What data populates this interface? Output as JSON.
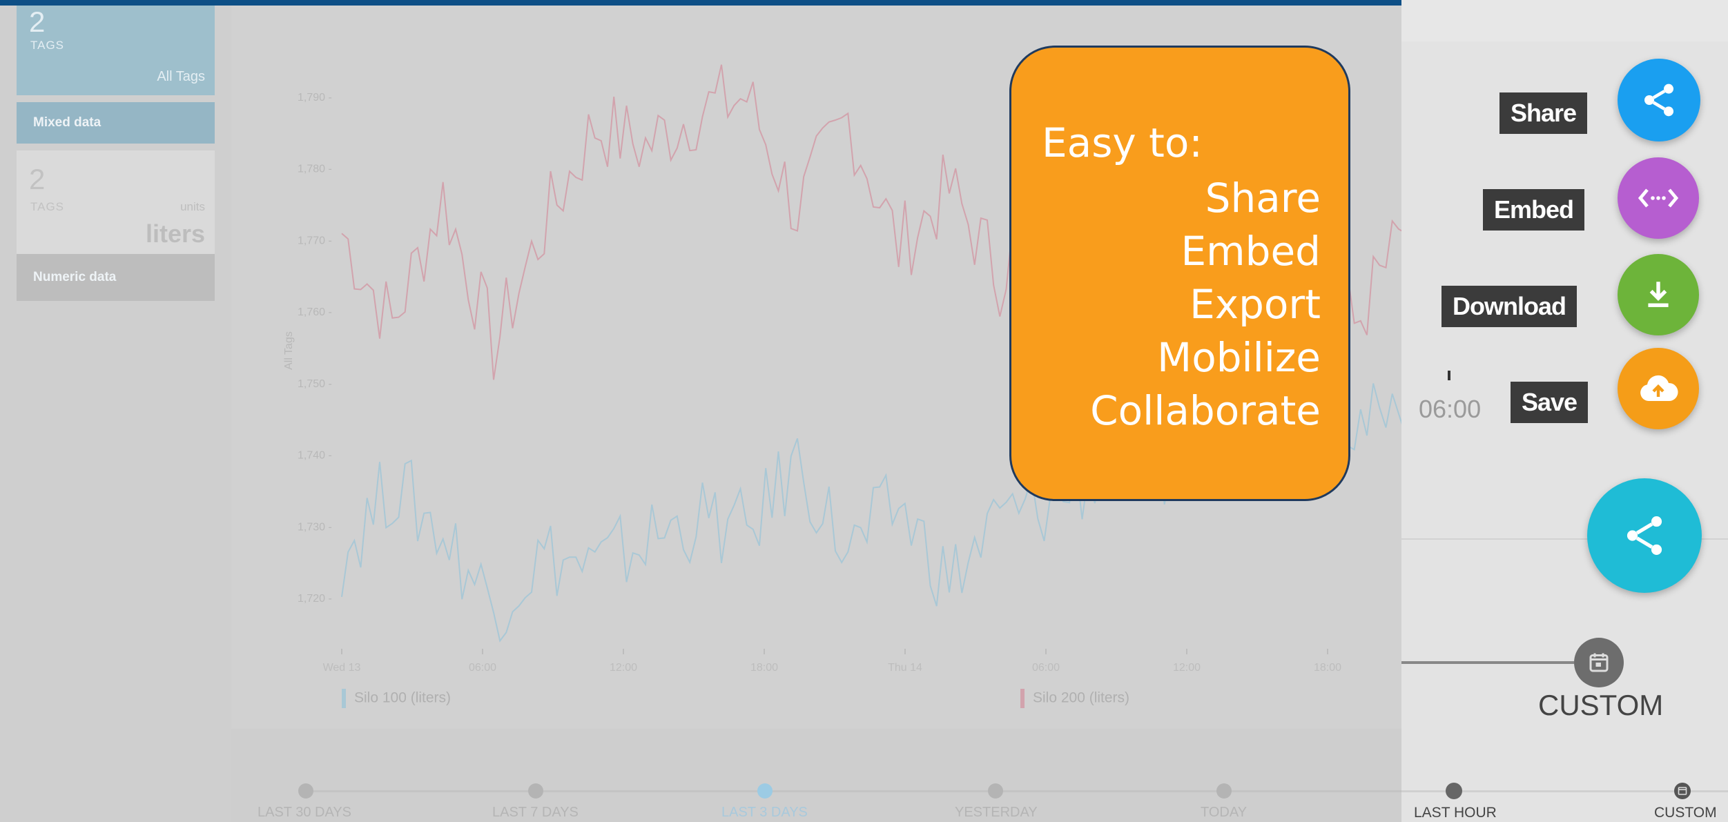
{
  "sidebar": {
    "card1": {
      "count": "2",
      "count_label": "TAGS",
      "right_label": "All Tags",
      "band": "Mixed data"
    },
    "card2": {
      "count": "2",
      "count_label": "TAGS",
      "units_label": "units",
      "units_value": "liters",
      "band": "Numeric data"
    }
  },
  "chart": {
    "ylabel": "All Tags",
    "y_ticks": [
      "1,790",
      "1,780",
      "1,770",
      "1,760",
      "1,750",
      "1,740",
      "1,730",
      "1,720"
    ],
    "x_ticks": [
      "Wed 13",
      "06:00",
      "12:00",
      "18:00",
      "Thu 14",
      "06:00",
      "12:00",
      "18:00"
    ],
    "legend": [
      {
        "name": "Silo 100 (liters)",
        "color": "#a9c8d6"
      },
      {
        "name": "Silo 200 (liters)",
        "color": "#d2a3ad"
      }
    ]
  },
  "chart_data": {
    "type": "line",
    "x": [
      "Wed 13",
      "06:00",
      "12:00",
      "18:00",
      "Thu 14",
      "06:00",
      "12:00",
      "18:00"
    ],
    "ylabel": "All Tags",
    "ylim": [
      1715,
      1795
    ],
    "series": [
      {
        "name": "Silo 200 (liters)",
        "values": [
          1771,
          1758,
          1776,
          1755,
          1772,
          1786,
          1783,
          1788,
          1790,
          1774,
          1787,
          1769,
          1777,
          1765,
          1783,
          1775,
          1776,
          1791,
          1782,
          1774,
          1758,
          1771
        ]
      },
      {
        "name": "Silo 100 (liters)",
        "values": [
          1726,
          1736,
          1729,
          1719,
          1726,
          1724,
          1728,
          1731,
          1729,
          1739,
          1726,
          1733,
          1722,
          1731,
          1733,
          1738,
          1736,
          1742,
          1744,
          1747,
          1745,
          1743
        ]
      }
    ]
  },
  "callout": {
    "title": "Easy to:",
    "items": [
      "Share",
      "Embed",
      "Export",
      "Mobilize",
      "Collaborate"
    ]
  },
  "timeline": {
    "items": [
      "LAST 30 DAYS",
      "LAST 7 DAYS",
      "LAST 3 DAYS",
      "YESTERDAY",
      "TODAY"
    ],
    "active": "LAST 3 DAYS"
  },
  "right_panel": {
    "actions": [
      {
        "label": "Share",
        "icon": "share-icon",
        "color": "#1a9ff0"
      },
      {
        "label": "Embed",
        "icon": "code-icon",
        "color": "#b65ed0"
      },
      {
        "label": "Download",
        "icon": "download-icon",
        "color": "#6db43a"
      },
      {
        "label": "Save",
        "icon": "cloud-upload-icon",
        "color": "#f59d18"
      }
    ],
    "main_fab_icon": "share-icon",
    "main_fab_color": "#1fbcd6",
    "time_label": "06:00",
    "custom_label": "CUSTOM",
    "timeline": [
      "LAST HOUR",
      "CUSTOM"
    ]
  }
}
